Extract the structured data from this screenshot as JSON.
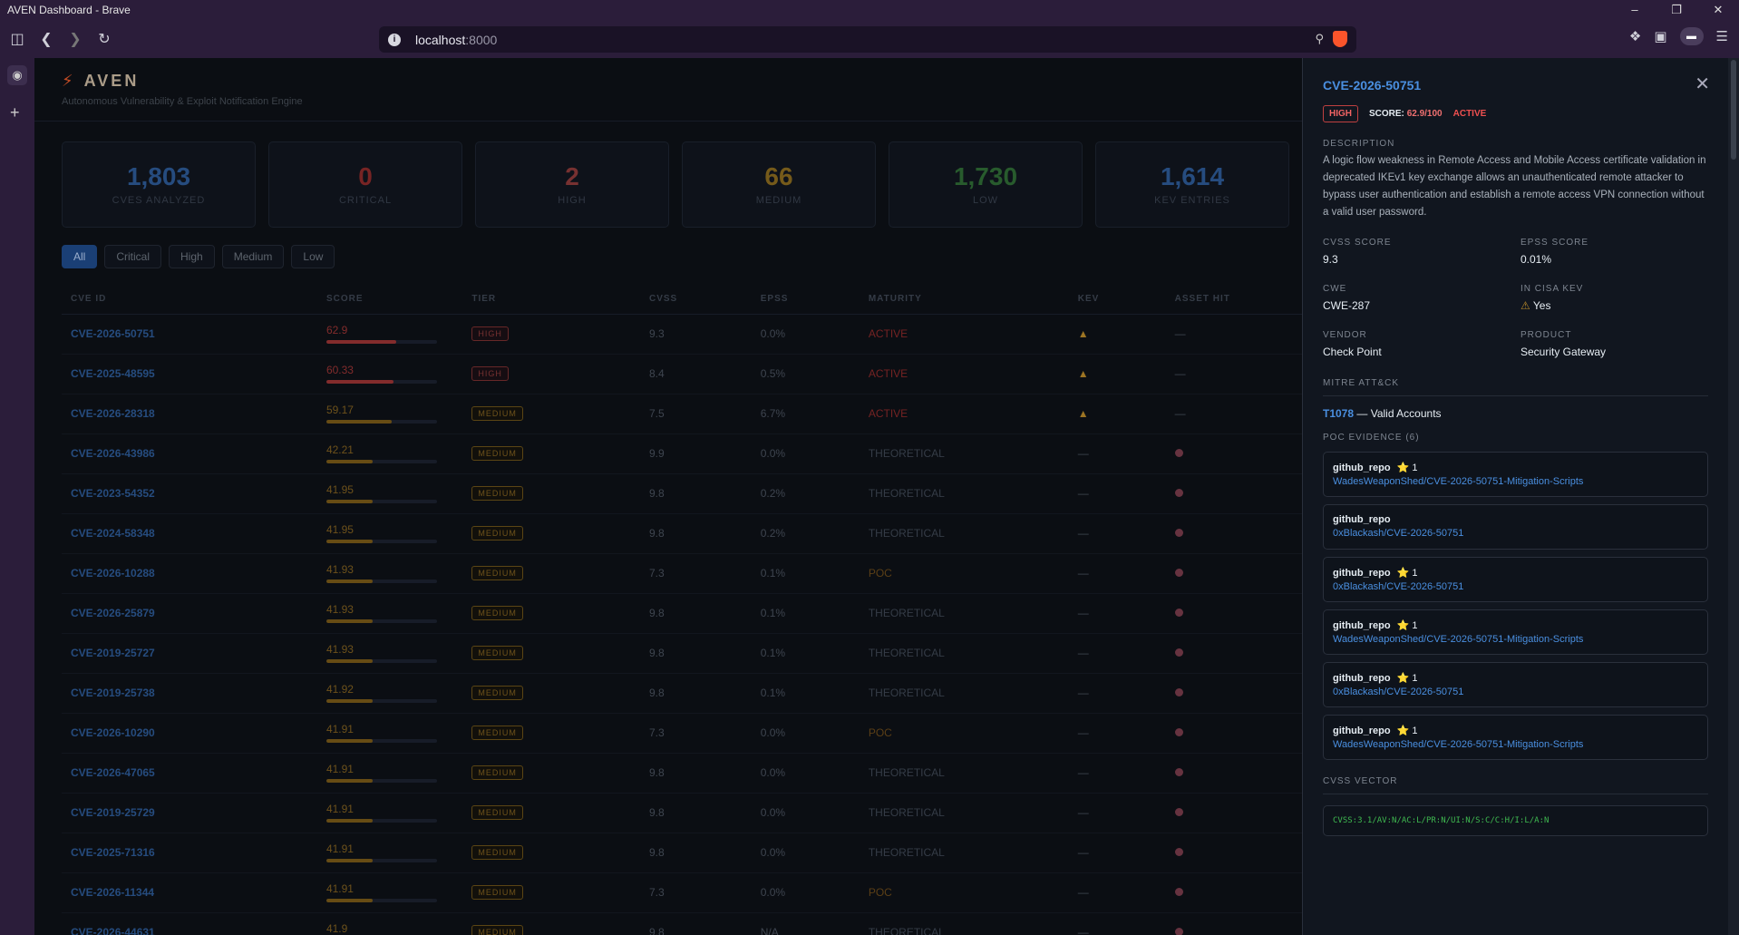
{
  "window": {
    "title": "AVEN Dashboard - Brave"
  },
  "browser": {
    "url_host": "localhost",
    "url_port": ":8000"
  },
  "app": {
    "name": "AVEN",
    "tagline": "Autonomous Vulnerability & Exploit Notification Engine"
  },
  "stats": [
    {
      "value": "1,803",
      "label": "CVEs Analyzed",
      "color": "#2d5a96"
    },
    {
      "value": "0",
      "label": "Critical",
      "color": "#8c2b2b"
    },
    {
      "value": "2",
      "label": "High",
      "color": "#8c3a3a"
    },
    {
      "value": "66",
      "label": "Medium",
      "color": "#8a6a1f"
    },
    {
      "value": "1,730",
      "label": "Low",
      "color": "#2f6b36"
    },
    {
      "value": "1,614",
      "label": "KEV Entries",
      "color": "#2d5a96"
    }
  ],
  "filters": [
    "All",
    "Critical",
    "High",
    "Medium",
    "Low"
  ],
  "table": {
    "headers": [
      "CVE ID",
      "Score",
      "Tier",
      "CVSS",
      "EPSS",
      "Maturity",
      "KEV",
      "Asset Hit"
    ],
    "rows": [
      {
        "id": "CVE-2026-50751",
        "score": "62.9",
        "pct": 62.9,
        "tier": "HIGH",
        "cvss": "9.3",
        "epss": "0.0%",
        "maturity": "ACTIVE",
        "kev": true,
        "asset": false
      },
      {
        "id": "CVE-2025-48595",
        "score": "60.33",
        "pct": 60.33,
        "tier": "HIGH",
        "cvss": "8.4",
        "epss": "0.5%",
        "maturity": "ACTIVE",
        "kev": true,
        "asset": false
      },
      {
        "id": "CVE-2026-28318",
        "score": "59.17",
        "pct": 59.17,
        "tier": "MEDIUM",
        "cvss": "7.5",
        "epss": "6.7%",
        "maturity": "ACTIVE",
        "kev": true,
        "asset": false
      },
      {
        "id": "CVE-2026-43986",
        "score": "42.21",
        "pct": 42.21,
        "tier": "MEDIUM",
        "cvss": "9.9",
        "epss": "0.0%",
        "maturity": "THEORETICAL",
        "kev": false,
        "asset": true
      },
      {
        "id": "CVE-2023-54352",
        "score": "41.95",
        "pct": 41.95,
        "tier": "MEDIUM",
        "cvss": "9.8",
        "epss": "0.2%",
        "maturity": "THEORETICAL",
        "kev": false,
        "asset": true
      },
      {
        "id": "CVE-2024-58348",
        "score": "41.95",
        "pct": 41.95,
        "tier": "MEDIUM",
        "cvss": "9.8",
        "epss": "0.2%",
        "maturity": "THEORETICAL",
        "kev": false,
        "asset": true
      },
      {
        "id": "CVE-2026-10288",
        "score": "41.93",
        "pct": 41.93,
        "tier": "MEDIUM",
        "cvss": "7.3",
        "epss": "0.1%",
        "maturity": "POC",
        "kev": false,
        "asset": true
      },
      {
        "id": "CVE-2026-25879",
        "score": "41.93",
        "pct": 41.93,
        "tier": "MEDIUM",
        "cvss": "9.8",
        "epss": "0.1%",
        "maturity": "THEORETICAL",
        "kev": false,
        "asset": true
      },
      {
        "id": "CVE-2019-25727",
        "score": "41.93",
        "pct": 41.93,
        "tier": "MEDIUM",
        "cvss": "9.8",
        "epss": "0.1%",
        "maturity": "THEORETICAL",
        "kev": false,
        "asset": true
      },
      {
        "id": "CVE-2019-25738",
        "score": "41.92",
        "pct": 41.92,
        "tier": "MEDIUM",
        "cvss": "9.8",
        "epss": "0.1%",
        "maturity": "THEORETICAL",
        "kev": false,
        "asset": true
      },
      {
        "id": "CVE-2026-10290",
        "score": "41.91",
        "pct": 41.91,
        "tier": "MEDIUM",
        "cvss": "7.3",
        "epss": "0.0%",
        "maturity": "POC",
        "kev": false,
        "asset": true
      },
      {
        "id": "CVE-2026-47065",
        "score": "41.91",
        "pct": 41.91,
        "tier": "MEDIUM",
        "cvss": "9.8",
        "epss": "0.0%",
        "maturity": "THEORETICAL",
        "kev": false,
        "asset": true
      },
      {
        "id": "CVE-2019-25729",
        "score": "41.91",
        "pct": 41.91,
        "tier": "MEDIUM",
        "cvss": "9.8",
        "epss": "0.0%",
        "maturity": "THEORETICAL",
        "kev": false,
        "asset": true
      },
      {
        "id": "CVE-2025-71316",
        "score": "41.91",
        "pct": 41.91,
        "tier": "MEDIUM",
        "cvss": "9.8",
        "epss": "0.0%",
        "maturity": "THEORETICAL",
        "kev": false,
        "asset": true
      },
      {
        "id": "CVE-2026-11344",
        "score": "41.91",
        "pct": 41.91,
        "tier": "MEDIUM",
        "cvss": "7.3",
        "epss": "0.0%",
        "maturity": "POC",
        "kev": false,
        "asset": true
      },
      {
        "id": "CVE-2026-44631",
        "score": "41.9",
        "pct": 41.9,
        "tier": "MEDIUM",
        "cvss": "9.8",
        "epss": "N/A",
        "maturity": "THEORETICAL",
        "kev": false,
        "asset": true
      }
    ]
  },
  "detail": {
    "cve_id": "CVE-2026-50751",
    "tier": "HIGH",
    "score_label": "SCORE:",
    "score_value": "62.9/100",
    "maturity": "ACTIVE",
    "description_label": "Description",
    "description": "A logic flow weakness in Remote Access and Mobile Access certificate validation in deprecated IKEv1 key exchange allows an unauthenticated remote attacker to bypass user authentication and establish a remote access VPN connection without a valid user password.",
    "cvss_label": "CVSS Score",
    "cvss": "9.3",
    "epss_label": "EPSS Score",
    "epss": "0.01%",
    "cwe_label": "CWE",
    "cwe": "CWE-287",
    "kev_label": "In CISA KEV",
    "kev": "Yes",
    "vendor_label": "Vendor",
    "vendor": "Check Point",
    "product_label": "Product",
    "product": "Security Gateway",
    "mitre_label": "MITRE ATT&CK",
    "mitre_id": "T1078",
    "mitre_name": " — Valid Accounts",
    "poc_label": "POC Evidence (6)",
    "pocs": [
      {
        "type": "github_repo",
        "stars": "1",
        "repo": "WadesWeaponShed/CVE-2026-50751-Mitigation-Scripts"
      },
      {
        "type": "github_repo",
        "stars": "",
        "repo": "0xBlackash/CVE-2026-50751"
      },
      {
        "type": "github_repo",
        "stars": "1",
        "repo": "0xBlackash/CVE-2026-50751"
      },
      {
        "type": "github_repo",
        "stars": "1",
        "repo": "WadesWeaponShed/CVE-2026-50751-Mitigation-Scripts"
      },
      {
        "type": "github_repo",
        "stars": "1",
        "repo": "0xBlackash/CVE-2026-50751"
      },
      {
        "type": "github_repo",
        "stars": "1",
        "repo": "WadesWeaponShed/CVE-2026-50751-Mitigation-Scripts"
      }
    ],
    "vector_label": "CVSS Vector",
    "vector": "CVSS:3.1/AV:N/AC:L/PR:N/UI:N/S:C/C:H/I:L/A:N"
  }
}
